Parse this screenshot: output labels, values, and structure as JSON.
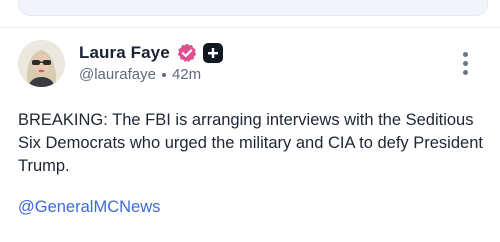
{
  "post": {
    "display_name": "Laura Faye",
    "handle": "@laurafaye",
    "time_ago": "42m",
    "text": "BREAKING: The FBI is arranging interviews with the Seditious Six Democrats who urged the military and CIA to defy President Trump.",
    "link_text": "@GeneralMCNews",
    "icons": {
      "verified": "verified-badge-icon",
      "subscriber": "plus-badge-icon",
      "more": "more-vertical-icon",
      "avatar": "avatar"
    }
  },
  "colors": {
    "verified_badge": "#e0508c",
    "link": "#3d6ae0",
    "secondary_text": "#5f6b7d",
    "primary_text": "#1e2633"
  }
}
